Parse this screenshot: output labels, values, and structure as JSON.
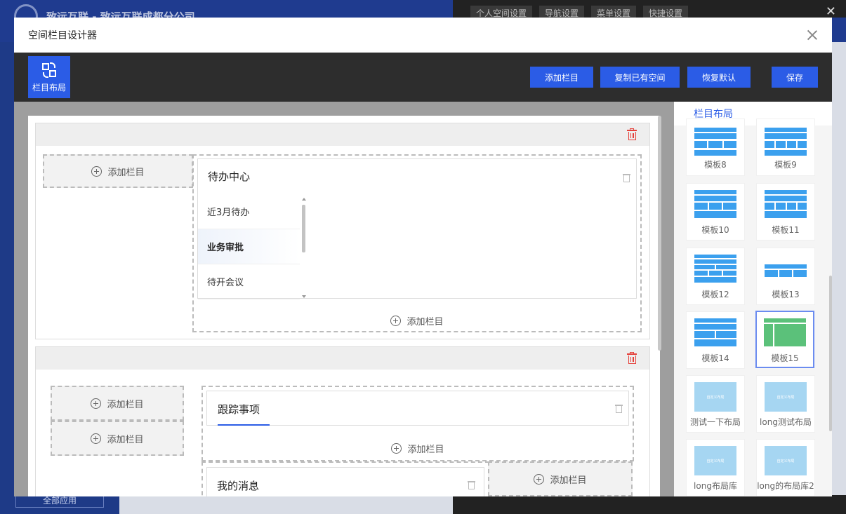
{
  "background": {
    "brand": "致远互联 - 致远互联成都分公司",
    "tabs": [
      "个人空间设置",
      "导航设置",
      "菜单设置",
      "快捷设置"
    ],
    "all_apps": "全部应用"
  },
  "modal": {
    "title": "空间栏目设计器",
    "sidebar_tab": "栏目布局"
  },
  "toolbar": {
    "add_column": "添加栏目",
    "copy_space": "复制已有空间",
    "restore_default": "恢复默认",
    "save": "保存"
  },
  "add_slot_label": "添加栏目",
  "section1": {
    "card_title": "待办中心",
    "list": [
      "近3月待办",
      "业务审批",
      "待开会议"
    ],
    "active_index": 1
  },
  "section2": {
    "card1_title": "跟踪事项",
    "card2_title": "我的消息"
  },
  "panel": {
    "title": "栏目布局",
    "templates": [
      {
        "label": "模板8"
      },
      {
        "label": "模板9"
      },
      {
        "label": "模板10"
      },
      {
        "label": "模板11"
      },
      {
        "label": "模板12"
      },
      {
        "label": "模板13"
      },
      {
        "label": "模板14"
      },
      {
        "label": "模板15"
      },
      {
        "label": "测试一下布局"
      },
      {
        "label": "long测试布局"
      },
      {
        "label": "long布局库"
      },
      {
        "label": "long的布局库2"
      }
    ],
    "custom_thumb_text": "自定义布局",
    "selected": "模板15"
  },
  "colors": {
    "accent": "#2b5ce6",
    "template_blue": "#3ba0ee",
    "template_green": "#5bc17a",
    "delete_red": "#e5403a"
  }
}
